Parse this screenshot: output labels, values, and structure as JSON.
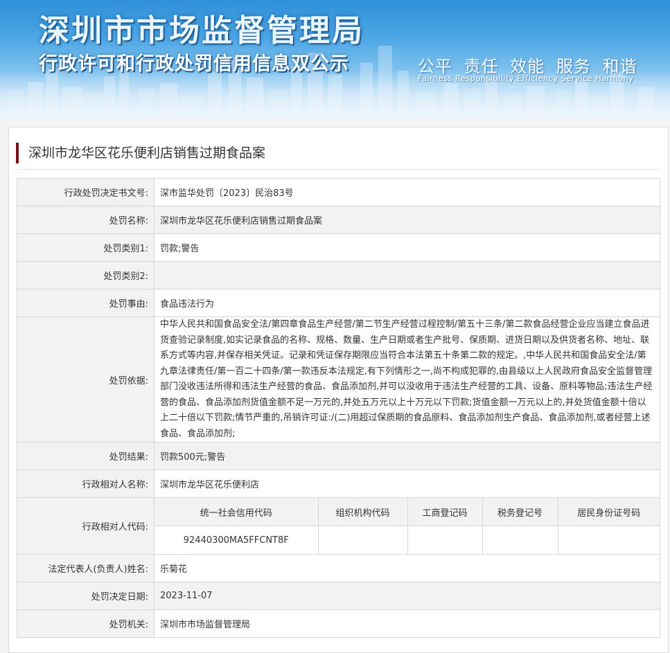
{
  "header": {
    "title": "深圳市市场监督管理局",
    "subtitle": "行政许可和行政处罚信用信息双公示",
    "slogan_cn": "公平 责任 效能 服务 和谐",
    "slogan_en": "Fairness Responsibility Efficiency Service Harmony"
  },
  "case_title": "深圳市龙华区花乐便利店销售过期食品案",
  "rows": {
    "doc_no": {
      "label": "行政处罚决定书文号:",
      "value": "深市监华处罚〔2023〕民治83号"
    },
    "name": {
      "label": "处罚名称:",
      "value": "深圳市龙华区花乐便利店销售过期食品案"
    },
    "cat1": {
      "label": "处罚类别1:",
      "value": "罚款;警告"
    },
    "cat2": {
      "label": "处罚类别2:",
      "value": ""
    },
    "cause": {
      "label": "处罚事由:",
      "value": "食品违法行为"
    },
    "basis": {
      "label": "处罚依据:",
      "value": "中华人民共和国食品安全法/第四章食品生产经营/第二节生产经营过程控制/第五十三条/第二款食品经营企业应当建立食品进货查验记录制度,如实记录食品的名称、规格、数量、生产日期或者生产批号、保质期、进货日期以及供货者名称、地址、联系方式等内容,并保存相关凭证。记录和凭证保存期限应当符合本法第五十条第二款的规定。,中华人民共和国食品安全法/第九章法律责任/第一百二十四条/第一款违反本法规定,有下列情形之一,尚不构成犯罪的,由县级以上人民政府食品安全监督管理部门没收违法所得和违法生产经营的食品、食品添加剂,并可以没收用于违法生产经营的工具、设备、原料等物品;违法生产经营的食品、食品添加剂货值金额不足一万元的,并处五万元以上十万元以下罚款;货值金额一万元以上的,并处货值金额十倍以上二十倍以下罚款;情节严重的,吊销许可证:/(二)用超过保质期的食品原料、食品添加剂生产食品、食品添加剂,或者经营上述食品、食品添加剂;"
    },
    "result": {
      "label": "处罚结果:",
      "value": "罚款500元;警告"
    },
    "party": {
      "label": "行政相对人名称:",
      "value": "深圳市龙华区花乐便利店"
    },
    "party_code": {
      "label": "行政相对人代码:",
      "headers": [
        "统一社会信用代码",
        "组织机构代码",
        "工商登记码",
        "税务登记号",
        "居民身份证号码"
      ],
      "values": [
        "92440300MA5FFCNT8F",
        "",
        "",
        "",
        ""
      ]
    },
    "legal_rep": {
      "label": "法定代表人(负责人)姓名:",
      "value": "乐菊花"
    },
    "decision_date": {
      "label": "处罚决定日期:",
      "value": "2023-11-07"
    },
    "authority": {
      "label": "处罚机关:",
      "value": "深圳市市场监督管理局"
    }
  }
}
